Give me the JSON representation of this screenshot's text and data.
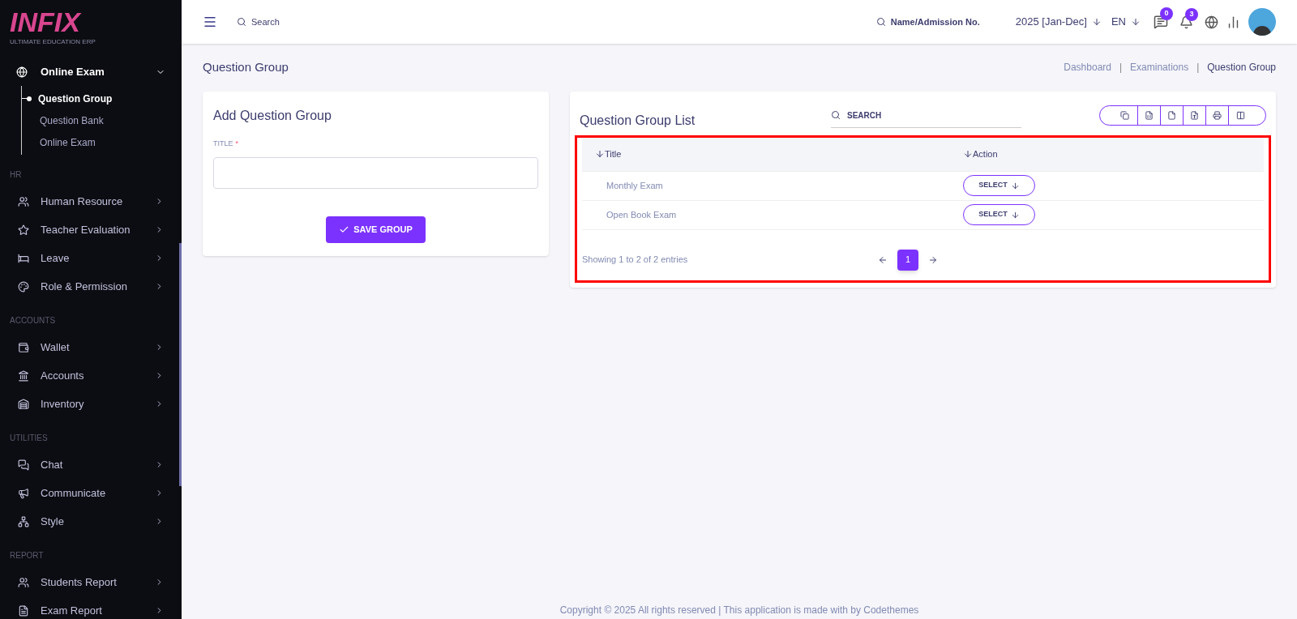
{
  "sidebar": {
    "logo": "INFIX",
    "logo_tagline": "ULTIMATE EDUCATION ERP",
    "active_menu": {
      "label": "Online Exam",
      "expanded": true,
      "children": [
        {
          "label": "Question Group",
          "selected": true
        },
        {
          "label": "Question Bank",
          "selected": false
        },
        {
          "label": "Online Exam",
          "selected": false
        }
      ]
    },
    "sections": [
      {
        "heading": "HR",
        "items": [
          "Human Resource",
          "Teacher Evaluation",
          "Leave",
          "Role & Permission"
        ]
      },
      {
        "heading": "ACCOUNTS",
        "items": [
          "Wallet",
          "Accounts",
          "Inventory"
        ]
      },
      {
        "heading": "UTILITIES",
        "items": [
          "Chat",
          "Communicate",
          "Style"
        ]
      },
      {
        "heading": "REPORT",
        "items": [
          "Students Report",
          "Exam Report"
        ]
      }
    ]
  },
  "header": {
    "search_placeholder": "Search",
    "student_search_placeholder": "Name/Admission No.",
    "session": "2025 [Jan-Dec]",
    "language": "EN",
    "messages_count": "0",
    "notifications_count": "3"
  },
  "page_title": "Question Group",
  "breadcrumbs": [
    "Dashboard",
    "Examinations",
    "Question Group"
  ],
  "breadcrumb_separator": "|",
  "form": {
    "title": "Add Question Group",
    "field_label": "TITLE",
    "required_mark": "*",
    "save_button": "SAVE GROUP"
  },
  "list": {
    "title": "Question Group List",
    "search_placeholder": "SEARCH",
    "columns": [
      "Title",
      "Action"
    ],
    "rows": [
      {
        "title": "Monthly Exam",
        "action": "SELECT"
      },
      {
        "title": "Open Book Exam",
        "action": "SELECT"
      }
    ],
    "summary": "Showing 1 to 2 of 2 entries",
    "pages": [
      {
        "label": "1",
        "selected": true
      }
    ]
  },
  "footer": "Copyright © 2025 All rights reserved | This application is made with by Codethemes"
}
